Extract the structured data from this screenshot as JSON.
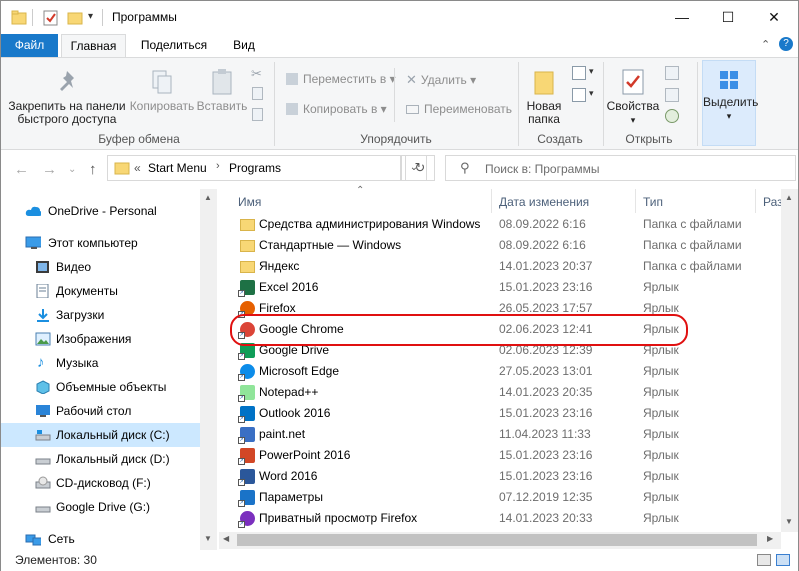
{
  "window": {
    "title": "Программы",
    "controls": {
      "minimize": "—",
      "maximize": "☐",
      "close": "✕"
    }
  },
  "ribbon_tabs": [
    "Файл",
    "Главная",
    "Поделиться",
    "Вид"
  ],
  "ribbon": {
    "clipboard": {
      "pin": "Закрепить на панели быстрого доступа",
      "pin_line1": "Закрепить на панели",
      "pin_line2": "быстрого доступа",
      "copy": "Копировать",
      "paste": "Вставить",
      "group": "Буфер обмена"
    },
    "organize": {
      "move": "Переместить в",
      "copy_to": "Копировать в",
      "delete": "Удалить",
      "rename": "Переименовать",
      "group": "Упорядочить"
    },
    "create": {
      "new_folder_line1": "Новая",
      "new_folder_line2": "папка",
      "group": "Создать"
    },
    "open": {
      "properties": "Свойства",
      "group": "Открыть"
    },
    "select": {
      "select": "Выделить"
    }
  },
  "address": {
    "prefix": "«",
    "path": [
      "Start Menu",
      "Programs"
    ],
    "search_placeholder": "Поиск в: Программы"
  },
  "nav_pane": [
    {
      "label": "OneDrive - Personal",
      "icon": "cloud-icon"
    },
    {
      "label": "Этот компьютер",
      "icon": "computer-icon"
    },
    {
      "label": "Видео",
      "icon": "video-folder-icon"
    },
    {
      "label": "Документы",
      "icon": "documents-folder-icon"
    },
    {
      "label": "Загрузки",
      "icon": "downloads-folder-icon"
    },
    {
      "label": "Изображения",
      "icon": "pictures-folder-icon"
    },
    {
      "label": "Музыка",
      "icon": "music-folder-icon"
    },
    {
      "label": "Объемные объекты",
      "icon": "3d-objects-folder-icon"
    },
    {
      "label": "Рабочий стол",
      "icon": "desktop-folder-icon"
    },
    {
      "label": "Локальный диск (C:)",
      "icon": "drive-icon"
    },
    {
      "label": "Локальный диск (D:)",
      "icon": "drive-icon"
    },
    {
      "label": "CD-дисковод (F:)",
      "icon": "cd-drive-icon"
    },
    {
      "label": "Google Drive (G:)",
      "icon": "google-drive-icon"
    },
    {
      "label": "Сеть",
      "icon": "network-icon"
    }
  ],
  "columns": {
    "name": "Имя",
    "date": "Дата изменения",
    "type": "Тип",
    "size": "Раз"
  },
  "files": [
    {
      "name": "Средства администрирования Windows",
      "date": "08.09.2022 6:16",
      "type": "Папка с файлами",
      "icon": "folder-icon",
      "color": "#f8d775"
    },
    {
      "name": "Стандартные — Windows",
      "date": "08.09.2022 6:16",
      "type": "Папка с файлами",
      "icon": "folder-icon",
      "color": "#f8d775"
    },
    {
      "name": "Яндекс",
      "date": "14.01.2023 20:37",
      "type": "Папка с файлами",
      "icon": "folder-icon",
      "color": "#f8d775"
    },
    {
      "name": "Excel 2016",
      "date": "15.01.2023 23:16",
      "type": "Ярлык",
      "icon": "excel-icon",
      "color": "#1e7145"
    },
    {
      "name": "Firefox",
      "date": "26.05.2023 17:57",
      "type": "Ярлык",
      "icon": "firefox-icon",
      "color": "#e66000"
    },
    {
      "name": "Google Chrome",
      "date": "02.06.2023 12:41",
      "type": "Ярлык",
      "icon": "chrome-icon",
      "color": "#db4437"
    },
    {
      "name": "Google Drive",
      "date": "02.06.2023 12:39",
      "type": "Ярлык",
      "icon": "google-drive-icon",
      "color": "#0f9d58"
    },
    {
      "name": "Microsoft Edge",
      "date": "27.05.2023 13:01",
      "type": "Ярлык",
      "icon": "edge-icon",
      "color": "#0c8ce9"
    },
    {
      "name": "Notepad++",
      "date": "14.01.2023 20:35",
      "type": "Ярлык",
      "icon": "notepadpp-icon",
      "color": "#90e59a"
    },
    {
      "name": "Outlook 2016",
      "date": "15.01.2023 23:16",
      "type": "Ярлык",
      "icon": "outlook-icon",
      "color": "#0072c6"
    },
    {
      "name": "paint.net",
      "date": "11.04.2023 11:33",
      "type": "Ярлык",
      "icon": "paintnet-icon",
      "color": "#3a6fc4"
    },
    {
      "name": "PowerPoint 2016",
      "date": "15.01.2023 23:16",
      "type": "Ярлык",
      "icon": "powerpoint-icon",
      "color": "#d24726"
    },
    {
      "name": "Word 2016",
      "date": "15.01.2023 23:16",
      "type": "Ярлык",
      "icon": "word-icon",
      "color": "#2b579a"
    },
    {
      "name": "Параметры",
      "date": "07.12.2019 12:35",
      "type": "Ярлык",
      "icon": "settings-icon",
      "color": "#1a73c8"
    },
    {
      "name": "Приватный просмотр Firefox",
      "date": "14.01.2023 20:33",
      "type": "Ярлык",
      "icon": "firefox-private-icon",
      "color": "#7b2fbe"
    }
  ],
  "status": {
    "items_count": "Элементов: 30"
  },
  "colors": {
    "accent": "#1979ca",
    "selection": "#cce8ff",
    "highlight_ring": "#e01010"
  }
}
